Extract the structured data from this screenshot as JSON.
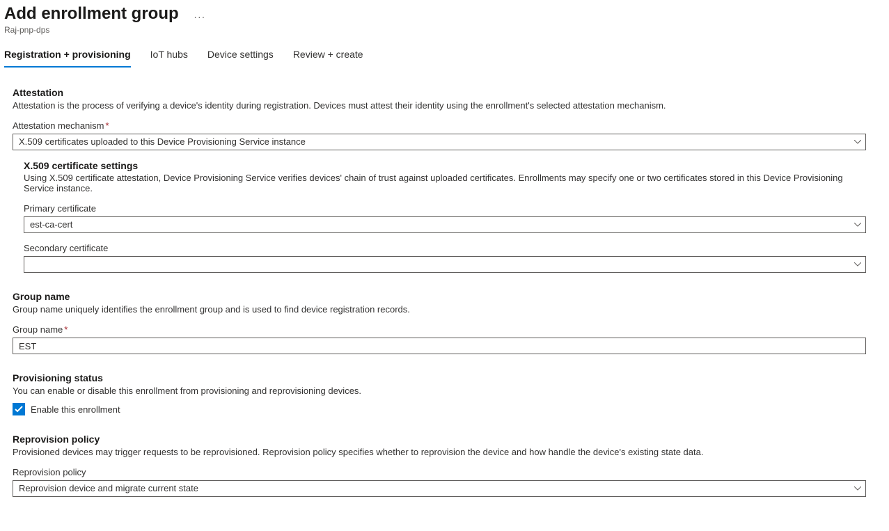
{
  "header": {
    "title": "Add enrollment group",
    "subtitle": "Raj-pnp-dps"
  },
  "tabs": [
    {
      "label": "Registration + provisioning",
      "active": true
    },
    {
      "label": "IoT hubs",
      "active": false
    },
    {
      "label": "Device settings",
      "active": false
    },
    {
      "label": "Review + create",
      "active": false
    }
  ],
  "attestation": {
    "heading": "Attestation",
    "desc": "Attestation is the process of verifying a device's identity during registration. Devices must attest their identity using the enrollment's selected attestation mechanism.",
    "mechanism_label": "Attestation mechanism",
    "mechanism_value": "X.509 certificates uploaded to this Device Provisioning Service instance"
  },
  "x509": {
    "heading": "X.509 certificate settings",
    "desc": "Using X.509 certificate attestation, Device Provisioning Service verifies devices' chain of trust against uploaded certificates. Enrollments may specify one or two certificates stored in this Device Provisioning Service instance.",
    "primary_label": "Primary certificate",
    "primary_value": "est-ca-cert",
    "secondary_label": "Secondary certificate",
    "secondary_value": ""
  },
  "group": {
    "heading": "Group name",
    "desc": "Group name uniquely identifies the enrollment group and is used to find device registration records.",
    "name_label": "Group name",
    "name_value": "EST"
  },
  "provisioning": {
    "heading": "Provisioning status",
    "desc": "You can enable or disable this enrollment from provisioning and reprovisioning devices.",
    "checkbox_label": "Enable this enrollment"
  },
  "reprovision": {
    "heading": "Reprovision policy",
    "desc": "Provisioned devices may trigger requests to be reprovisioned. Reprovision policy specifies whether to reprovision the device and how handle the device's existing state data.",
    "policy_label": "Reprovision policy",
    "policy_value": "Reprovision device and migrate current state"
  }
}
